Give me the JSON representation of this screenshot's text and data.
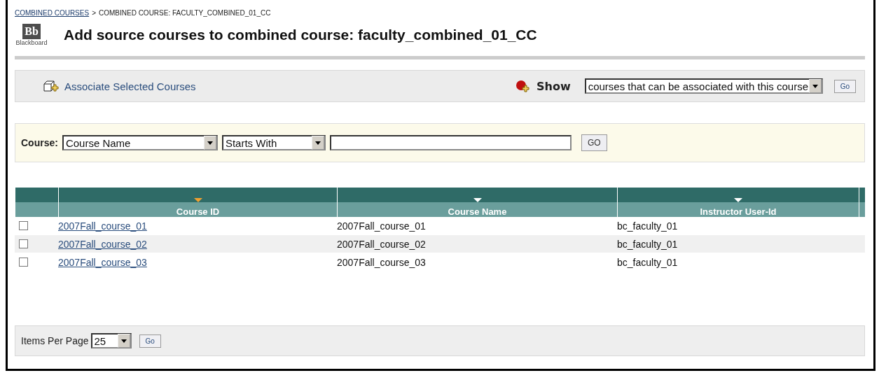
{
  "breadcrumb": [
    {
      "label": "COMBINED COURSES",
      "kind": "link"
    },
    {
      "label": "COMBINED COURSE: FACULTY_COMBINED_01_CC",
      "kind": "text"
    }
  ],
  "breadcrumb_separator": ">",
  "logo": {
    "mark": "Bb",
    "caption": "Blackboard"
  },
  "title": "Add source courses to combined course: faculty_combined_01_CC",
  "action_bar": {
    "associate_label": "Associate Selected Courses",
    "show_label": "Show",
    "show_value": "courses that can be associated with this course",
    "go": "Go"
  },
  "filter": {
    "label": "Course:",
    "field_value": "Course Name",
    "operator_value": "Starts With",
    "go": "GO"
  },
  "table": {
    "columns": [
      {
        "label": "Course ID",
        "sorted": true
      },
      {
        "label": "Course Name",
        "sorted": false
      },
      {
        "label": "Instructor User-Id",
        "sorted": false
      }
    ],
    "rows": [
      {
        "checked": false,
        "course_id": "2007Fall_course_01",
        "course_name": "2007Fall_course_01",
        "instructor": "bc_faculty_01"
      },
      {
        "checked": false,
        "course_id": "2007Fall_course_02",
        "course_name": "2007Fall_course_02",
        "instructor": "bc_faculty_01"
      },
      {
        "checked": false,
        "course_id": "2007Fall_course_03",
        "course_name": "2007Fall_course_03",
        "instructor": "bc_faculty_01"
      }
    ]
  },
  "footer": {
    "label": "Items Per Page",
    "value": "25",
    "go": "Go"
  }
}
